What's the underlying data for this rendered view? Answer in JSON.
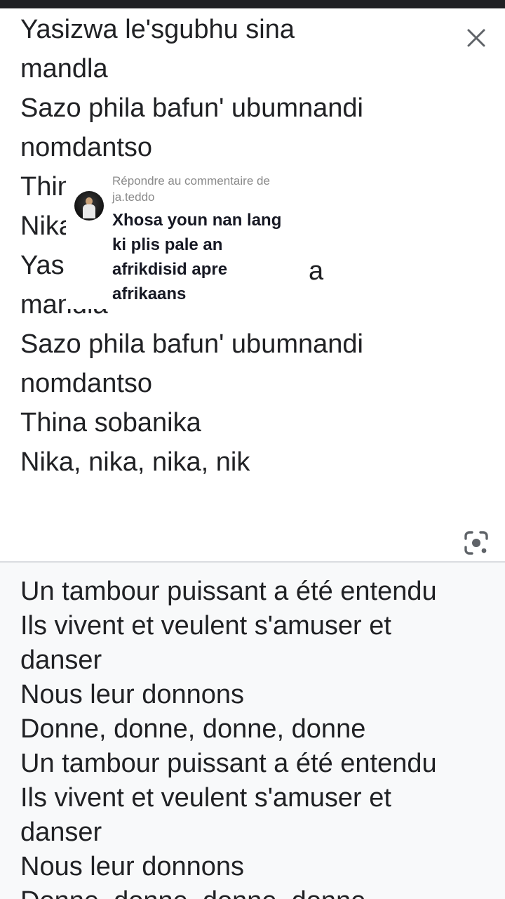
{
  "source_text": {
    "lines": [
      "Yasizwa le'sgubhu sina",
      "mandla",
      "Sazo phila bafun' ubumnandi",
      "nomdantso",
      "Thina sobanika",
      "Nika, nika, nika, nik",
      "Yasizwa le'sgubhu sina",
      "mandla",
      "Sazo phila bafun' ubumnandi",
      "nomdantso",
      "Thina sobanika",
      "Nika, nika, nika, nik"
    ],
    "overlay_stub": "a"
  },
  "translated_text": {
    "lines": [
      "Un tambour puissant a été entendu",
      "Ils vivent et veulent s'amuser et",
      "danser",
      "Nous leur donnons",
      "Donne, donne, donne, donne",
      "Un tambour puissant a été entendu",
      "Ils vivent et veulent s'amuser et",
      "danser",
      "Nous leur donnons",
      "Donne, donne, donne, donne"
    ]
  },
  "icons": {
    "close": "close-icon",
    "lens": "google-lens-icon",
    "avatar": "avatar"
  },
  "comment_overlay": {
    "context": "Répondre au commentaire de ja.teddo",
    "comment": "Xhosa youn nan lang ki plis pale an afrikdisid apre afrikaans"
  },
  "colors": {
    "text": "#202124",
    "bottom_background": "#f8f9fa",
    "divider": "#dadce0",
    "icon": "#5f6368"
  }
}
